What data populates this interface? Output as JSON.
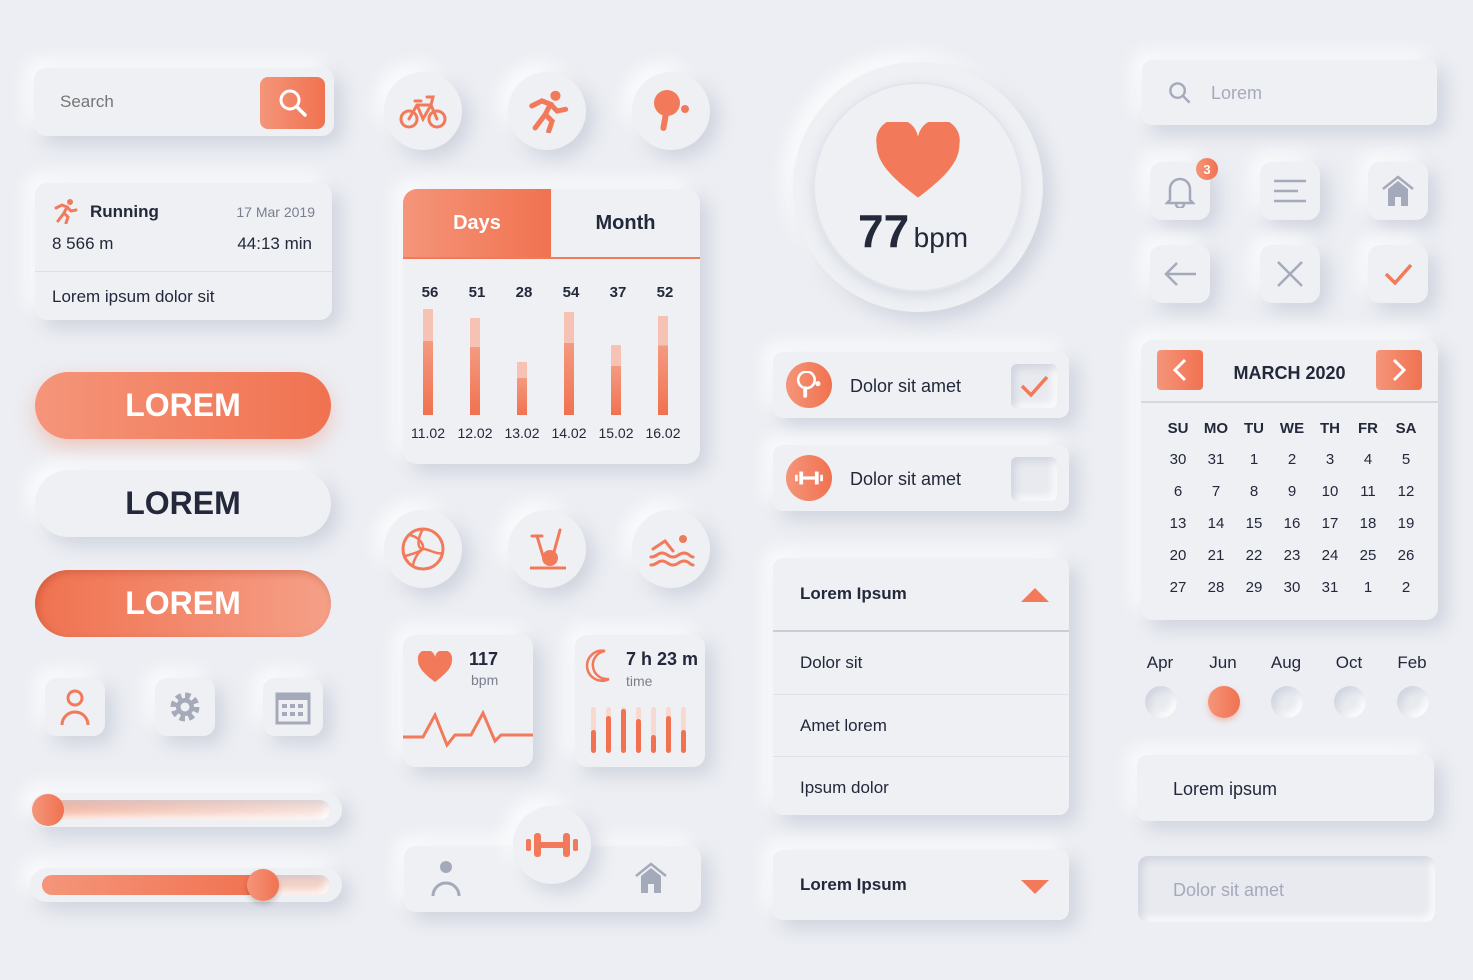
{
  "accent": "#f27a5a",
  "search": {
    "placeholder": "Search"
  },
  "running": {
    "title": "Running",
    "date": "17 Mar 2019",
    "distance": "8 566 m",
    "duration": "44:13 min",
    "note": "Lorem ipsum dolor sit"
  },
  "buttons": [
    "LOREM",
    "LOREM",
    "LOREM"
  ],
  "sliders": [
    0.05,
    0.75
  ],
  "chart_data": {
    "type": "bar",
    "tabs": [
      "Days",
      "Month"
    ],
    "active_tab": "Days",
    "categories": [
      "11.02",
      "12.02",
      "13.02",
      "14.02",
      "15.02",
      "16.02"
    ],
    "values": [
      56,
      51,
      28,
      54,
      37,
      52
    ]
  },
  "heart": {
    "value": "117",
    "unit": "bpm"
  },
  "sleep": {
    "value": "7 h 23 m",
    "label": "time",
    "bars": [
      0.5,
      0.8,
      0.95,
      0.75,
      0.4,
      0.8,
      0.5
    ]
  },
  "bpm": {
    "value": "77",
    "unit": "bpm"
  },
  "checks": [
    {
      "label": "Dolor sit amet",
      "checked": true
    },
    {
      "label": "Dolor sit amet",
      "checked": false
    }
  ],
  "accordion": {
    "header": "Lorem Ipsum",
    "items": [
      "Dolor sit",
      "Amet lorem",
      "Ipsum dolor"
    ]
  },
  "dropdown": {
    "header": "Lorem Ipsum"
  },
  "right_search": {
    "placeholder": "Lorem"
  },
  "notif_count": "3",
  "calendar": {
    "title": "MARCH 2020",
    "days": [
      "SU",
      "MO",
      "TU",
      "WE",
      "TH",
      "FR",
      "SA"
    ],
    "weeks": [
      [
        "30",
        "31",
        "1",
        "2",
        "3",
        "4",
        "5"
      ],
      [
        "6",
        "7",
        "8",
        "9",
        "10",
        "11",
        "12"
      ],
      [
        "13",
        "14",
        "15",
        "16",
        "17",
        "18",
        "19"
      ],
      [
        "20",
        "21",
        "22",
        "23",
        "24",
        "25",
        "26"
      ],
      [
        "27",
        "28",
        "29",
        "30",
        "31",
        "1",
        "2"
      ]
    ]
  },
  "months": {
    "labels": [
      "Apr",
      "Jun",
      "Aug",
      "Oct",
      "Feb"
    ],
    "selected": 1
  },
  "inputs": {
    "value": "Lorem ipsum",
    "placeholder": "Dolor sit amet"
  }
}
